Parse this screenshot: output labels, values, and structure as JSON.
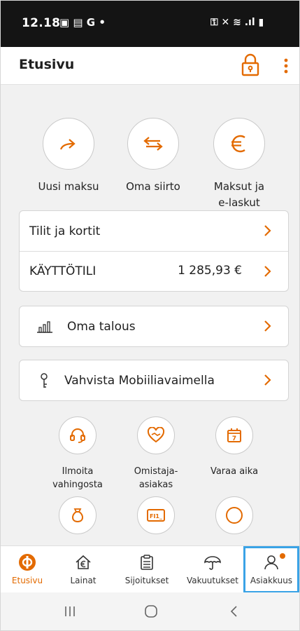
{
  "status_bar": {
    "time": "12.18",
    "left_icons": "▣ ▤ G •",
    "right_icons": "⚿ ✕ ≋ .ıl ▮"
  },
  "header": {
    "title": "Etusivu"
  },
  "quick_actions": [
    {
      "label": "Uusi maksu"
    },
    {
      "label": "Oma siirto"
    },
    {
      "label_line1": "Maksut ja",
      "label_line2": "e-laskut"
    }
  ],
  "accounts_card": {
    "title": "Tilit ja kortit",
    "account_name": "KÄYTTÖTILI",
    "account_balance": "1 285,93 €"
  },
  "finance_row": {
    "label": "Oma talous"
  },
  "verify_row": {
    "label": "Vahvista Mobiiliavaimella"
  },
  "services": [
    {
      "line1": "Ilmoita",
      "line2": "vahingosta"
    },
    {
      "line1": "Omistaja-",
      "line2": "asiakas"
    },
    {
      "line1": "Varaa aika",
      "line2": ""
    }
  ],
  "calendar_icon_number": "7",
  "doc_icon_text": "FI1_",
  "tabs": [
    {
      "label": "Etusivu"
    },
    {
      "label": "Lainat"
    },
    {
      "label": "Sijoitukset"
    },
    {
      "label": "Vakuutukset"
    },
    {
      "label": "Asiakkuus"
    }
  ],
  "nav": {
    "recents": "|||",
    "home": "◯",
    "back": "<"
  },
  "colors": {
    "accent": "#e36a00",
    "status_bar": "#141414",
    "background": "#f1f1f1",
    "highlight": "#3aa3e6"
  }
}
